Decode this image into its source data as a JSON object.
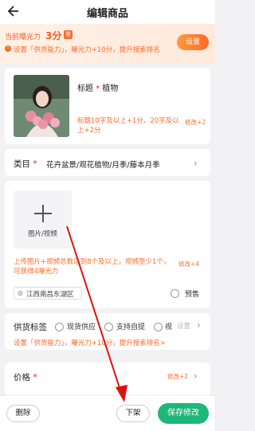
{
  "header": {
    "title": "编辑商品",
    "back_icon": "back-arrow-icon"
  },
  "banner": {
    "exposure_label": "当前曝光力",
    "exposure_value": "3分",
    "badge": "差",
    "tip": "设置「供货能力」，曝光力+10分，提升搜索排名",
    "set_button": "设置"
  },
  "title_section": {
    "label": "标题",
    "required_star": "*",
    "value": "植物",
    "hint": "标题10字及以上+1分，20字及以上+2分",
    "tag": "修改+2"
  },
  "category": {
    "label": "类目",
    "required_star": "*",
    "value": "花卉盆景/观花植物/月季/藤本月季"
  },
  "media": {
    "upload_label": "图片/视频",
    "hint": "上传图片+视频总数达到8个及以上，视频至少1个，可获得4曝光力",
    "tag": "修改+4",
    "location": "江西南昌东湖区",
    "presale_label": "预售"
  },
  "supply": {
    "label": "供货标签",
    "options": [
      "现货供应",
      "支持自提",
      "视"
    ],
    "set_label": "设置",
    "tip": "设置「供货能力」，曝光力+10分，提升搜索排名>"
  },
  "price": {
    "label": "价格",
    "required_star": "*",
    "tag": "修改+2"
  },
  "bottom_bar": {
    "delete": "删除",
    "take_down": "下架",
    "save": "保存修改"
  },
  "colors": {
    "accent": "#ff6a2a",
    "save_green": "#1db77a",
    "arrow_red": "#e01010"
  }
}
